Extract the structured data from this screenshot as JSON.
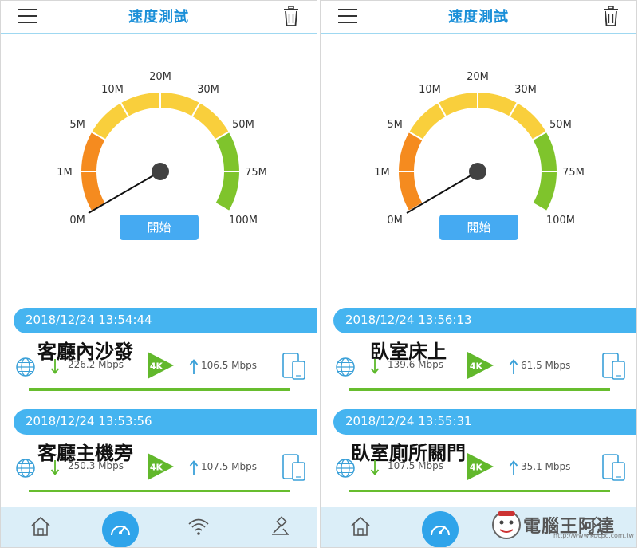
{
  "title": "速度測試",
  "start_label": "開始",
  "gauge_labels": [
    "0M",
    "1M",
    "5M",
    "10M",
    "20M",
    "30M",
    "50M",
    "75M",
    "100M"
  ],
  "colors": {
    "accent": "#45b4f0",
    "orange": "#f58b1f",
    "yellow": "#f9cf3c",
    "green": "#7fc42c",
    "title": "#1a8fd8"
  },
  "icons": {
    "menu": "hamburger-icon",
    "delete": "trash-icon",
    "network": "globe-icon",
    "devices": "devices-icon",
    "play": "play-4k-icon"
  },
  "badge_4k": "4K",
  "panels": [
    {
      "results": [
        {
          "timestamp": "2018/12/24 13:54:44",
          "place": "客廳內沙發",
          "download": "226.2 Mbps",
          "upload": "106.5 Mbps"
        },
        {
          "timestamp": "2018/12/24 13:53:56",
          "place": "客廳主機旁",
          "download": "250.3 Mbps",
          "upload": "107.5 Mbps"
        }
      ]
    },
    {
      "results": [
        {
          "timestamp": "2018/12/24 13:56:13",
          "place": "臥室床上",
          "download": "139.6 Mbps",
          "upload": "61.5 Mbps"
        },
        {
          "timestamp": "2018/12/24 13:55:31",
          "place": "臥室廁所關門",
          "download": "107.5 Mbps",
          "upload": "35.1 Mbps"
        }
      ]
    }
  ],
  "watermark": {
    "text": "電腦王阿達",
    "url": "http://www.kocpc.com.tw"
  }
}
